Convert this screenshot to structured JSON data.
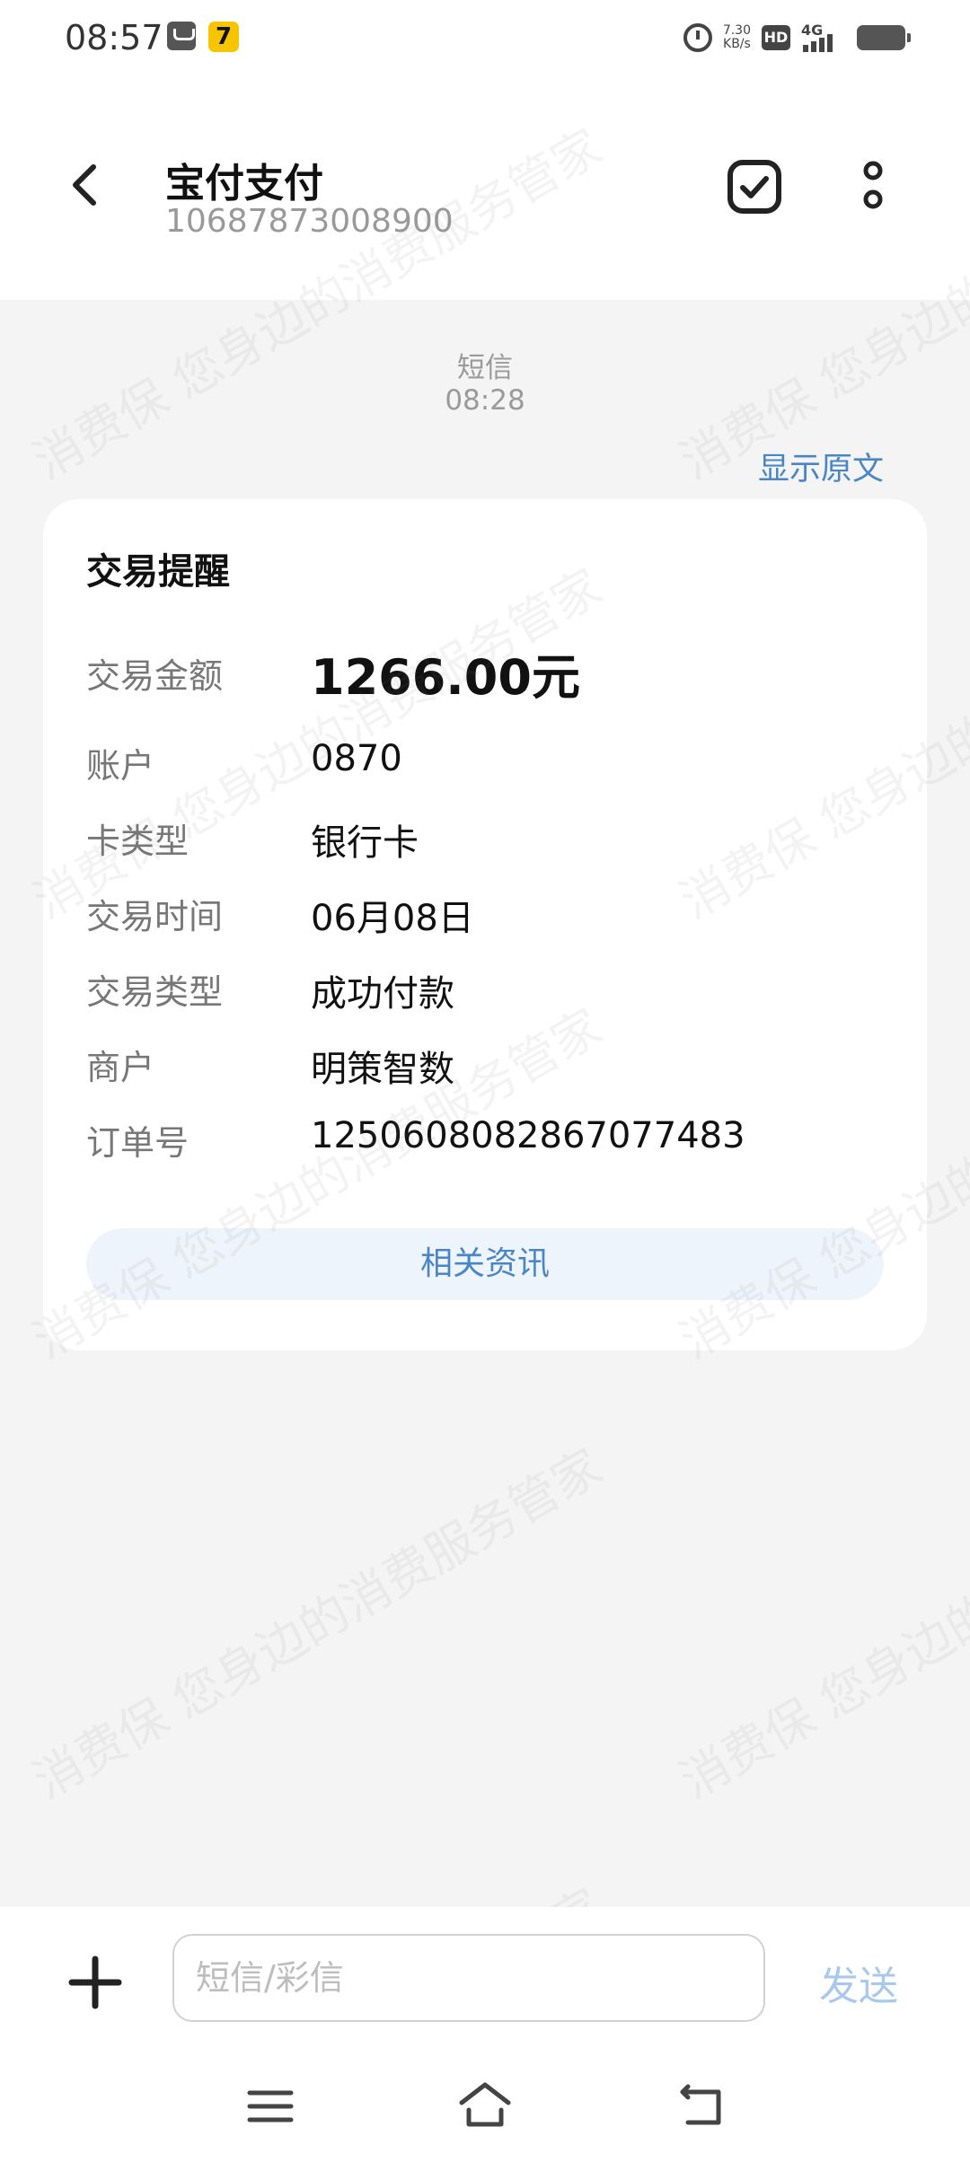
{
  "status_bar": {
    "time": "08:57",
    "net_speed_value": "7.30",
    "net_speed_unit": "KB/s",
    "hd_label": "HD",
    "network_label": "4G",
    "icons": [
      "alarm-icon",
      "hd-icon",
      "signal-icon",
      "battery-icon"
    ]
  },
  "header": {
    "title": "宝付支付",
    "subtitle": "10687873008900",
    "icons": [
      "back-arrow-icon",
      "checkbox-icon",
      "more-vertical-icon"
    ]
  },
  "message": {
    "kind": "短信",
    "time": "08:28",
    "show_original": "显示原文"
  },
  "card": {
    "title": "交易提醒",
    "rows": [
      {
        "label": "交易金额",
        "value": "1266.00元"
      },
      {
        "label": "账户",
        "value": "0870"
      },
      {
        "label": "卡类型",
        "value": "银行卡"
      },
      {
        "label": "交易时间",
        "value": "06月08日"
      },
      {
        "label": "交易类型",
        "value": "成功付款"
      },
      {
        "label": "商户",
        "value": "明策智数"
      },
      {
        "label": "订单号",
        "value": "1250608082867077483"
      }
    ],
    "related_button": "相关资讯"
  },
  "watermark": {
    "line1": "消费保 您身边的消费服务管家"
  },
  "composer": {
    "placeholder": "短信/彩信",
    "value": "",
    "send_label": "发送",
    "icons": [
      "plus-icon"
    ]
  },
  "nav": {
    "icons": [
      "menu-icon",
      "home-icon",
      "back-icon"
    ]
  },
  "colors": {
    "accent": "#4a86c6",
    "send_disabled": "#a8c9ec",
    "background": "#f4f4f4"
  }
}
